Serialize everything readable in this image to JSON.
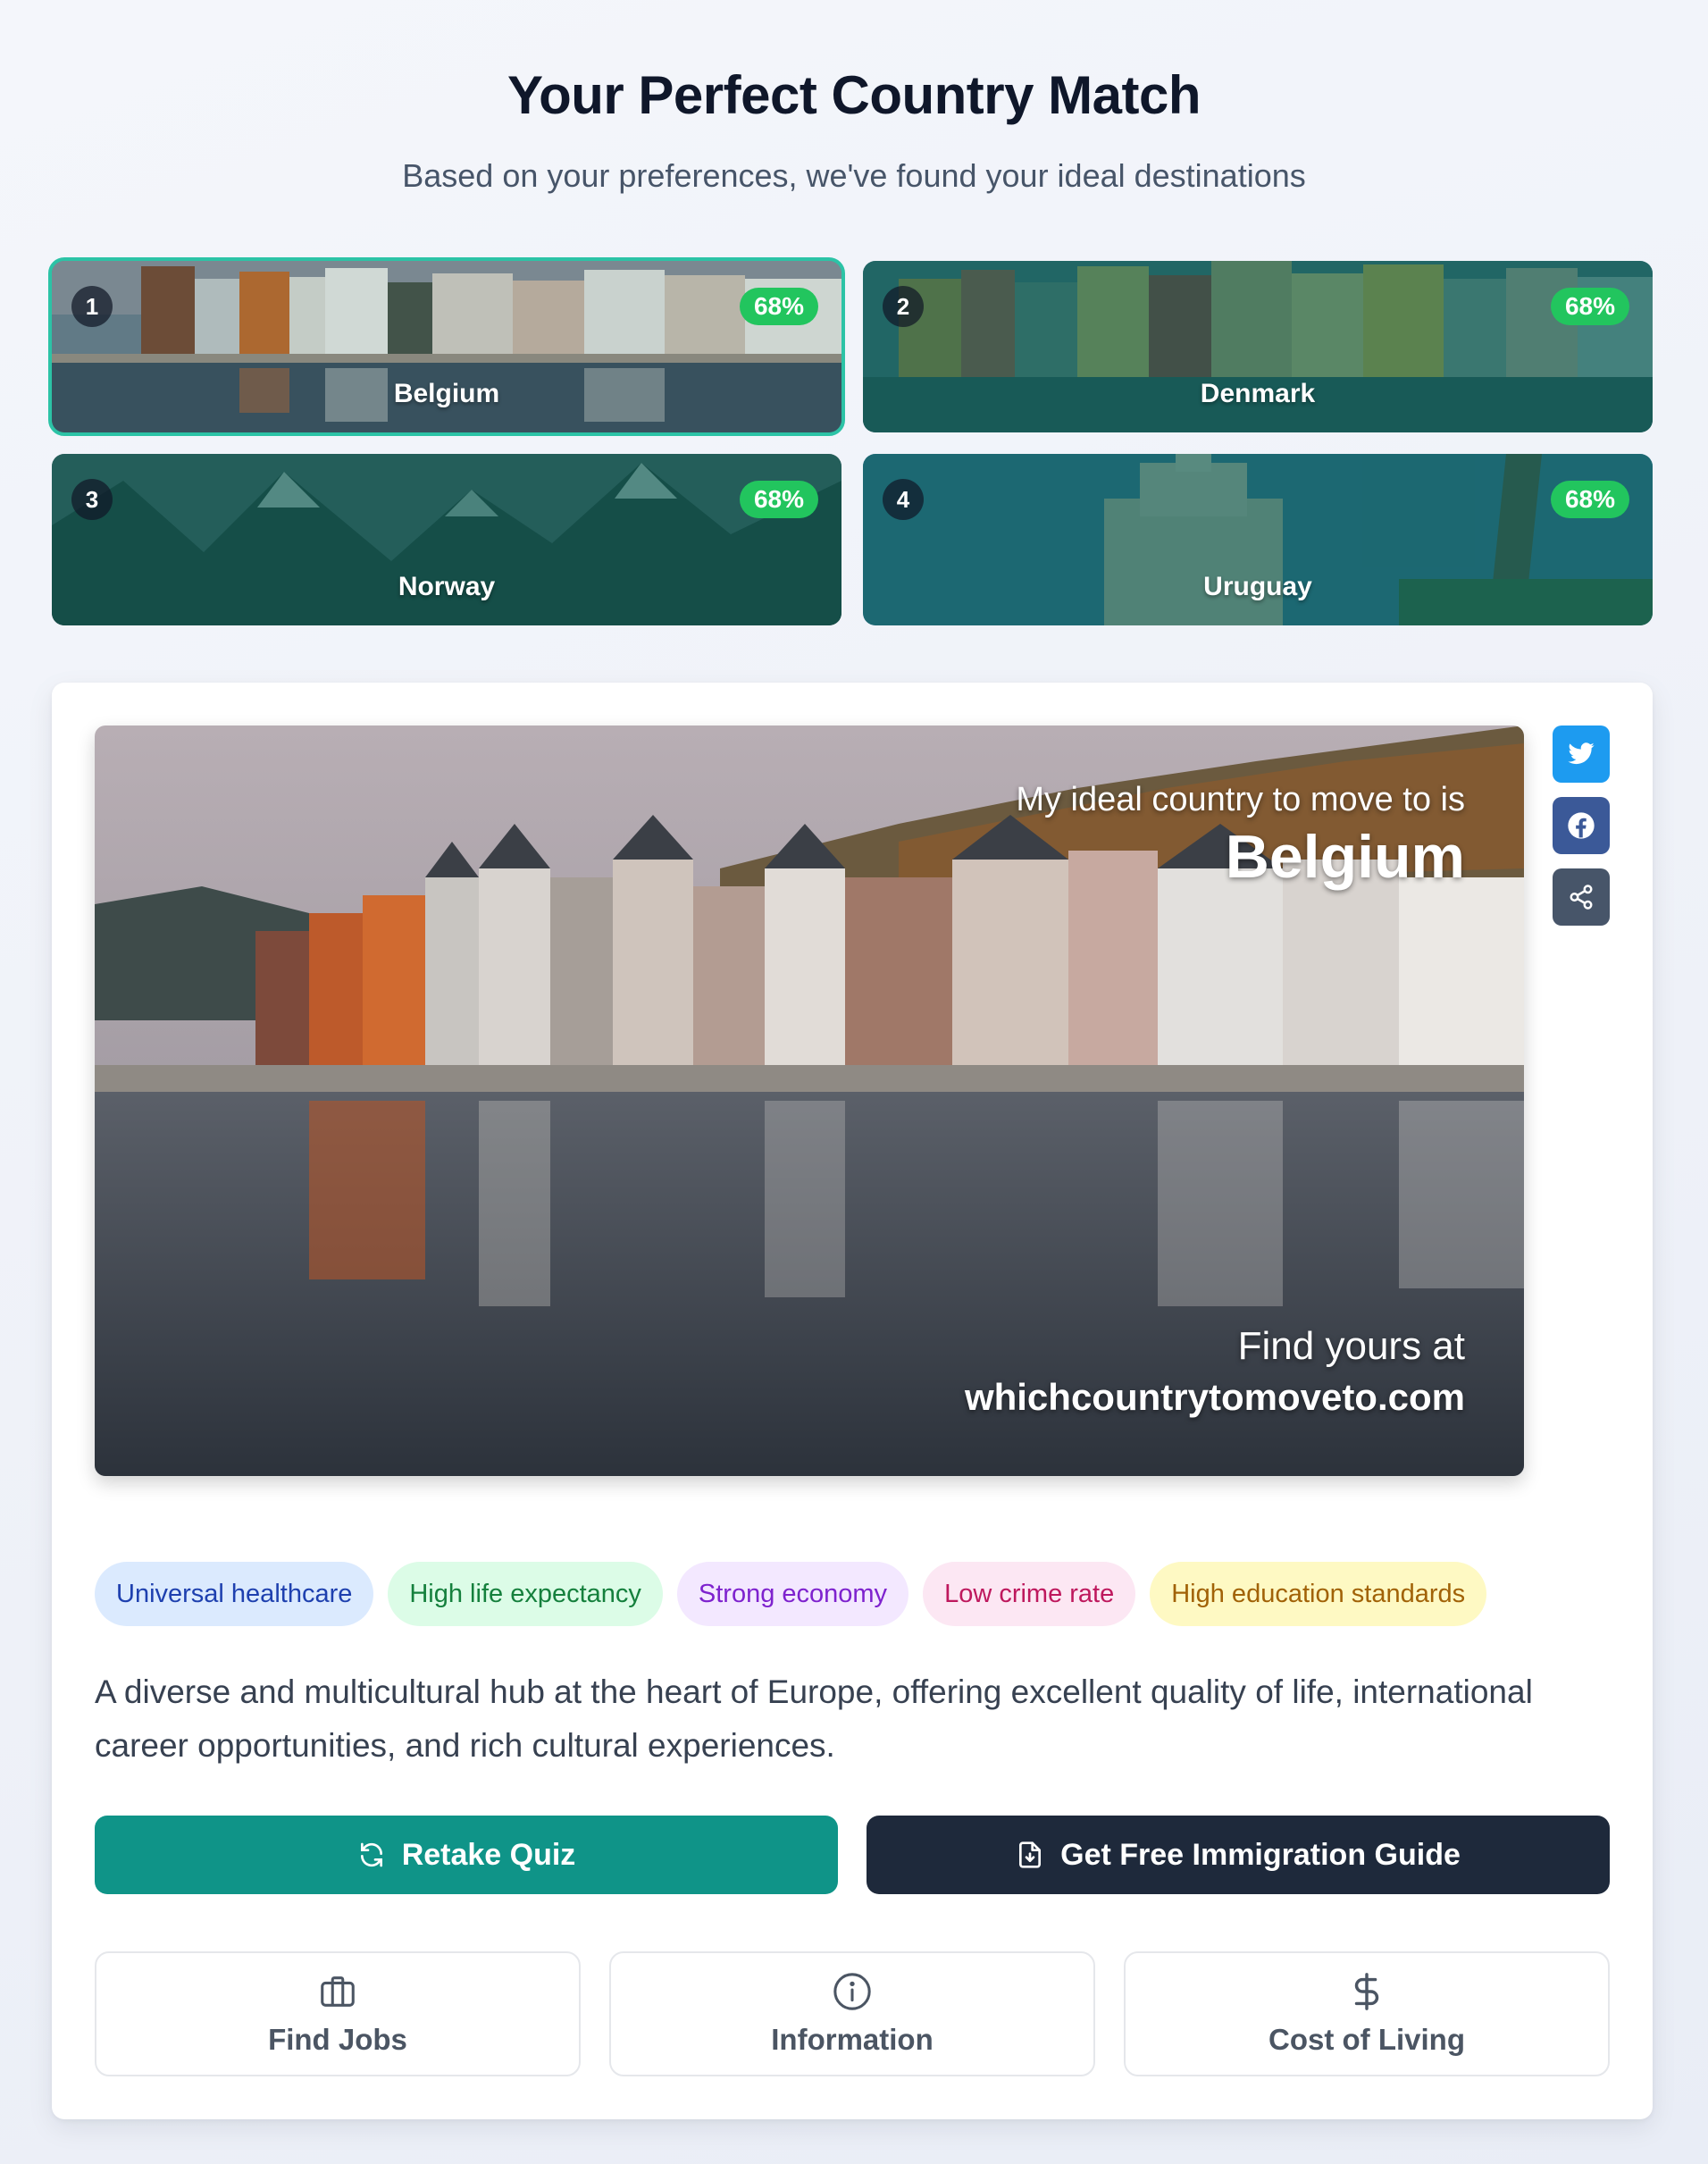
{
  "header": {
    "title": "Your Perfect Country Match",
    "subtitle": "Based on your preferences, we've found your ideal destinations"
  },
  "matches": [
    {
      "rank": "1",
      "name": "Belgium",
      "percent": "68%",
      "selected": true
    },
    {
      "rank": "2",
      "name": "Denmark",
      "percent": "68%",
      "selected": false
    },
    {
      "rank": "3",
      "name": "Norway",
      "percent": "68%",
      "selected": false
    },
    {
      "rank": "4",
      "name": "Uruguay",
      "percent": "68%",
      "selected": false
    }
  ],
  "share_image": {
    "line1": "My ideal country to move to is",
    "country": "Belgium",
    "find_text": "Find yours at",
    "site": "whichcountrytomoveto.com"
  },
  "social": {
    "icons": [
      "twitter-icon",
      "facebook-icon",
      "share-icon"
    ]
  },
  "tags": [
    "Universal healthcare",
    "High life expectancy",
    "Strong economy",
    "Low crime rate",
    "High education standards"
  ],
  "description": "A diverse and multicultural hub at the heart of Europe, offering excellent quality of life, international career opportunities, and rich cultural experiences.",
  "actions": {
    "retake_label": "Retake Quiz",
    "guide_label": "Get Free Immigration Guide"
  },
  "tiles": [
    {
      "label": "Find Jobs",
      "icon": "briefcase-icon"
    },
    {
      "label": "Information",
      "icon": "info-icon"
    },
    {
      "label": "Cost of Living",
      "icon": "dollar-icon"
    }
  ],
  "colors": {
    "accent_teal": "#0f9488",
    "selected_outline": "#2cc3a6",
    "match_badge": "#22c55e",
    "dark_button": "#1e293b",
    "twitter": "#1d9bf0",
    "facebook": "#3b5998"
  }
}
